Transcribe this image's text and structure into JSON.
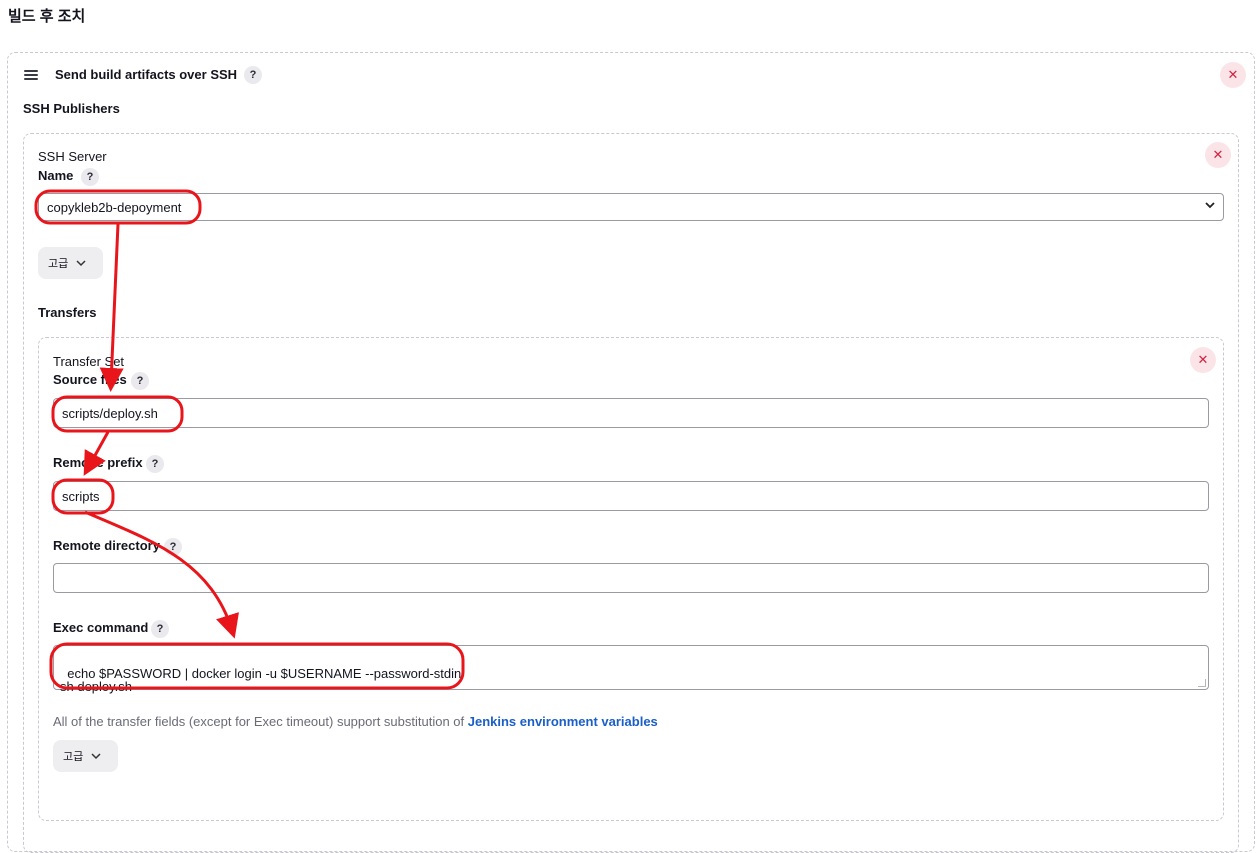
{
  "page": {
    "section_title": "빌드 후 조치"
  },
  "step": {
    "title": "Send build artifacts over SSH",
    "help": "?",
    "close": "✕",
    "publishers_label": "SSH Publishers"
  },
  "server": {
    "title": "SSH Server",
    "name_label": "Name",
    "help": "?",
    "close": "✕",
    "name_value": "copykleb2b-depoyment",
    "advanced_label": "고급",
    "transfers_label": "Transfers"
  },
  "transfer_set": {
    "title": "Transfer Set",
    "close": "✕",
    "source_files_label": "Source files",
    "source_files_value": "scripts/deploy.sh",
    "remove_prefix_label": "Remove prefix",
    "remove_prefix_value": "scripts",
    "remote_directory_label": "Remote directory",
    "remote_directory_value": "",
    "exec_command_label": "Exec command",
    "exec_command_value": "echo $PASSWORD | docker login -u $USERNAME --password-stdin\nsh deploy.sh",
    "note_prefix": "All of the transfer fields (except for Exec timeout) support substitution of ",
    "note_link": "Jenkins environment variables",
    "advanced_label": "고급",
    "help": "?"
  },
  "colors": {
    "annotation": "#e8151b",
    "link": "#1a5fc7",
    "close_bg": "#fbe4e7",
    "close_fg": "#d4213f"
  }
}
